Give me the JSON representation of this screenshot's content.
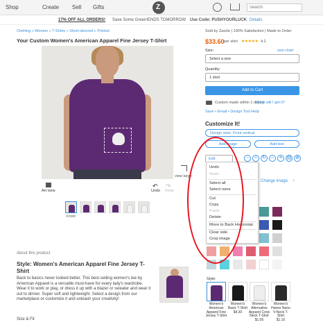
{
  "nav": {
    "shop": "Shop",
    "create": "Create",
    "sell": "Sell",
    "gifts": "Gifts",
    "search_placeholder": "Search"
  },
  "promo": {
    "off": "17% OFF ALL ORDERS!",
    "save": "Save Some Green!",
    "ends": "ENDS TOMORROW",
    "code": "Use Code: PUSHYOURLUCK",
    "details": "Details"
  },
  "breadcrumb": "Clothing  »  Women  »  T-Shirts  »  Short-sleeved  »  Printed",
  "title": "Your Custom Women's American Apparel Fine Jersey T-Shirt",
  "product": {
    "view_large": "view large",
    "art_view": "Art view",
    "undo": "Undo",
    "redo": "Redo",
    "undo_icon": "↶",
    "redo_icon": "↷",
    "thumb_front": "Front",
    "thumbnails": [
      "front",
      "back",
      "side",
      "model-back",
      "blank-front",
      "blank-back"
    ]
  },
  "right": {
    "sold_by": "Sold by Zazzle  |  100% Satisfaction  |  Made to Order",
    "price": "$33.60",
    "per_shirt": "per shirt",
    "stars": "★★★★★",
    "rating": "4.2",
    "size_label": "Size:",
    "size_chart": "size chart",
    "size_value": "Select a size",
    "qty_label": "Quantity:",
    "qty_value": "1 shirt",
    "add_to_cart": "Add to Cart",
    "made_text": "Custom made within 1 day(s)",
    "when_link": "When will I get it?",
    "share_row": "Save  •  Email  •  Design Tool Help",
    "customize": "Customize It!",
    "design_btn": "Design view:  Front vertical",
    "add_image": "Add image",
    "add_text": "Add text",
    "edit": "Edit",
    "change_image": "Change image",
    "close": "×",
    "style_label": "Style:"
  },
  "menu": {
    "undo": "Undo",
    "redo": "Redo",
    "select_all": "Select all",
    "select_none": "Select none",
    "cut": "Cut",
    "copy": "Copy",
    "paste": "Paste",
    "delete": "Delete",
    "move_back": "Move to Back Horizontal",
    "clear_side": "Clear side",
    "crop_image": "Crop image"
  },
  "colors": {
    "accent": "#3a95e6",
    "brand_purple": "#5c2a72",
    "price": "#e65a00",
    "annotation": "#e8141c",
    "swatches": [
      "#3a4a7a",
      "#2a7a5a",
      "#c4283a",
      "#3a8a3a",
      "#4a9a9a",
      "#7a2a5a",
      "#9a2a6a",
      "#5c2a72",
      "#8a8a8a",
      "#2a3a8a",
      "#3a5ab4",
      "#1a1a1a",
      "#f08aa0",
      "#f0c060",
      "#f0e070",
      "#9ad0f0",
      "#80c0d0",
      "#d0d0d0",
      "#f0a0a0",
      "#f0b070",
      "#f080b0",
      "#e05a70",
      "#f06a7a",
      "#e0e0e0",
      "#c0d8e0",
      "#5ad0e0",
      "#e8e8e8",
      "#f0d0d0",
      "#ffffff",
      "#f4f4f4"
    ]
  },
  "styles": [
    {
      "name": "Women's American Apparel Fine Jersey T-Shirt",
      "shirt_color": "#5c2a72"
    },
    {
      "name": "Women's Basic T-Shirt\n$4.30",
      "shirt_color": "#1a1a1a"
    },
    {
      "name": "Women's Alternative Apparel Crew Neck T-Shirt\n$1.05",
      "shirt_color": "#eeeeee"
    },
    {
      "name": "Women's Hanes Nano V-Neck T-Shirt\n$1.10",
      "shirt_color": "#2a2a2a"
    }
  ],
  "about": {
    "head": "About this product",
    "title": "Style: Women's American Apparel Fine Jersey T-Shirt",
    "desc": "Back to basics never looked better. This best-selling women's tee by American Apparel is a versatile must-have for every lady's wardrobe. Wear it to work or play, or dress it up with a blazer or sweater and wear it out to dinner. Super soft and lightweight. Select a design from our marketplace or customize it and unleash your creativity!",
    "size_fit": "Size & Fit"
  }
}
